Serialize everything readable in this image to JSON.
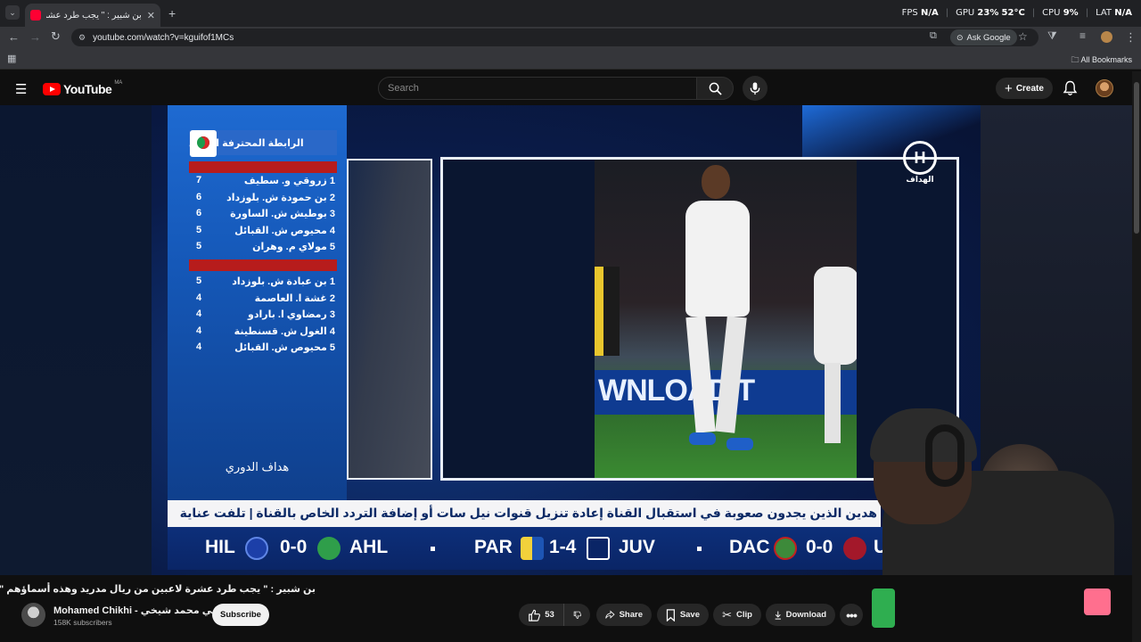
{
  "browser": {
    "tab_title": "بن شبير : \" يجب طرد عشرة لاعبين",
    "url": "youtube.com/watch?v=kguifof1MCs",
    "ask_google": "Ask Google",
    "all_bookmarks": "All Bookmarks",
    "hud": {
      "fps_label": "FPS",
      "fps": "N/A",
      "gpu_label": "GPU",
      "gpu_load": "23%",
      "gpu_temp": "52°C",
      "cpu_label": "CPU",
      "cpu_load": "9%",
      "lat_label": "LAT",
      "lat": "N/A"
    }
  },
  "youtube": {
    "logo": "YouTube",
    "country": "MA",
    "search_placeholder": "Search",
    "create_label": "Create"
  },
  "video": {
    "panel": {
      "header": "الرابطة المحترفة الأولى",
      "table1": [
        {
          "name": "1 زروقي  و. سطيف",
          "pts": "7"
        },
        {
          "name": "2 بن حمودة  ش. بلوزداد",
          "pts": "6"
        },
        {
          "name": "3 بوطيش  ش. الساورة",
          "pts": "6"
        },
        {
          "name": "4 محيوص  ش. القبائل",
          "pts": "5"
        },
        {
          "name": "5 مولاي  م. وهران",
          "pts": "5"
        }
      ],
      "table2": [
        {
          "name": "1 بن عبادة  ش. بلوزداد",
          "pts": "5"
        },
        {
          "name": "2 غشة  ا. العاصمة",
          "pts": "4"
        },
        {
          "name": "3 رمضاوي  ا. بارادو",
          "pts": "4"
        },
        {
          "name": "4 الغول  ش. قسنطينة",
          "pts": "4"
        },
        {
          "name": "5 محيوص  ش. القبائل",
          "pts": "4"
        }
      ],
      "footer": "هداف الدوري"
    },
    "photo_board": "WNLOAD T",
    "channel_logo_text": "الهداف",
    "ticker": "هدين الذين يجدون صعوبة في استقبال القناة إعادة تنزيل قنوات نيل سات أو إضافة التردد الخاص بالقناة | تلفت عناية",
    "scores": [
      {
        "home": "HIL",
        "score": "0-0",
        "away": "AHL"
      },
      {
        "home": "PAR",
        "score": "1-4",
        "away": "JUV"
      },
      {
        "home": "DAC",
        "score": "0-0",
        "away": "US"
      }
    ]
  },
  "meta": {
    "title": "بن شبير : \" يجب طرد عشرة لاعبين من ريال مدريد وهذه أسماؤهم \"",
    "channel": "Mohamed Chikhi - الإعلامي محمد شيخي",
    "subscribers": "158K subscribers",
    "subscribe": "Subscribe",
    "likes": "53",
    "share": "Share",
    "save": "Save",
    "clip": "Clip",
    "download": "Download"
  }
}
